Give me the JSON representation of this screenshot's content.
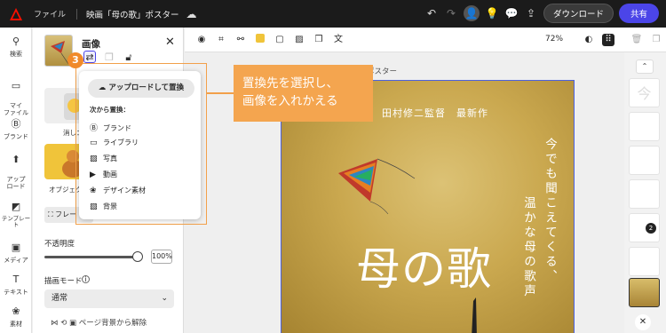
{
  "topbar": {
    "file_label": "ファイル",
    "doc_title": "映画「母の歌」ポスター",
    "download_label": "ダウンロード",
    "share_label": "共有"
  },
  "leftrail": {
    "items": [
      {
        "label": "検索",
        "icon": "search-icon"
      },
      {
        "label": "マイ\nファイル",
        "icon": "file-icon"
      },
      {
        "label": "ブランド",
        "icon": "brand-icon"
      },
      {
        "label": "アップ\nロード",
        "icon": "upload-icon"
      },
      {
        "label": "テンプレート",
        "icon": "template-icon"
      },
      {
        "label": "メディア",
        "icon": "media-icon"
      },
      {
        "label": "テキスト",
        "icon": "text-icon"
      },
      {
        "label": "素材",
        "icon": "elements-icon"
      }
    ]
  },
  "panel": {
    "title": "画像",
    "suggestion_1": "消しゴ",
    "suggestion_2": "オブジェクト",
    "frame_label": "フレー",
    "opacity_label": "不透明度",
    "opacity_value": "100%",
    "opacity_level": 1.0,
    "blend_label": "描画モード",
    "blend_value": "通常",
    "bottom_text": "ページ背景から解除"
  },
  "toolbar": {
    "zoom": "72%"
  },
  "poster": {
    "caption": "ポスター",
    "director": "田村修二監督　最新作",
    "main_title": "母の歌",
    "vertical_1": "今でも聞こえてくる、",
    "vertical_2": "温かな母の歌声"
  },
  "dropdown": {
    "upload_label": "アップロードして置換",
    "replace_from": "次から置換：",
    "items": [
      "ブランド",
      "ライブラリ",
      "写真",
      "動画",
      "デザイン素材",
      "背景"
    ]
  },
  "annotation": {
    "step": "3",
    "callout_line1": "置換先を選択し、",
    "callout_line2": "画像を入れかえる"
  },
  "rightpanel": {
    "page_first": "今",
    "badge": "2"
  },
  "colors": {
    "accent": "#4b45e8",
    "annotation": "#f4a54f"
  }
}
